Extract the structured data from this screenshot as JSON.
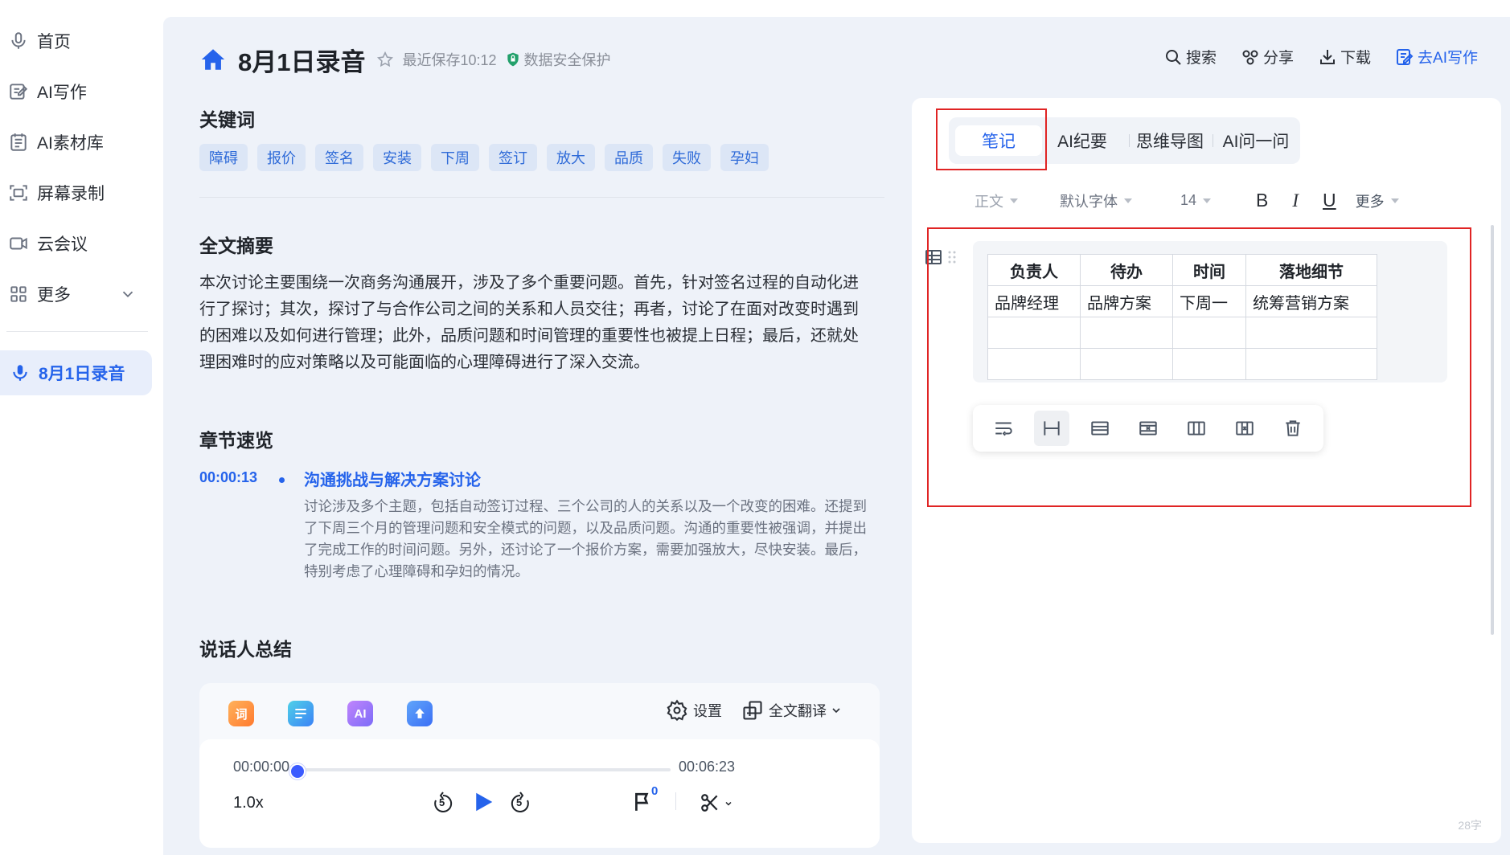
{
  "sidebar": {
    "items": [
      {
        "label": "首页",
        "icon": "microphone-icon"
      },
      {
        "label": "AI写作",
        "icon": "edit-icon"
      },
      {
        "label": "AI素材库",
        "icon": "library-icon"
      },
      {
        "label": "屏幕录制",
        "icon": "screen-record-icon"
      },
      {
        "label": "云会议",
        "icon": "video-icon"
      },
      {
        "label": "更多",
        "icon": "grid-icon"
      }
    ],
    "recent": {
      "label": "8月1日录音",
      "icon": "microphone-icon"
    }
  },
  "header": {
    "title": "8月1日录音",
    "save_status": "最近保存10:12",
    "security": "数据安全保护",
    "actions": {
      "search": "搜索",
      "share": "分享",
      "download": "下载",
      "ai_write": "去AI写作"
    }
  },
  "keywords": {
    "title": "关键词",
    "items": [
      "障碍",
      "报价",
      "签名",
      "安装",
      "下周",
      "签订",
      "放大",
      "品质",
      "失败",
      "孕妇"
    ]
  },
  "summary": {
    "title": "全文摘要",
    "text": "本次讨论主要围绕一次商务沟通展开，涉及了多个重要问题。首先，针对签名过程的自动化进行了探讨；其次，探讨了与合作公司之间的关系和人员交往；再者，讨论了在面对改变时遇到的困难以及如何进行管理；此外，品质问题和时间管理的重要性也被提上日程；最后，还就处理困难时的应对策略以及可能面临的心理障碍进行了深入交流。"
  },
  "chapters": {
    "title": "章节速览",
    "items": [
      {
        "time": "00:00:13",
        "title": "沟通挑战与解决方案讨论",
        "body": "讨论涉及多个主题，包括自动签订过程、三个公司的人的关系以及一个改变的困难。还提到了下周三个月的管理问题和安全模式的问题，以及品质问题。沟通的重要性被强调，并提出了完成工作的时间问题。另外，还讨论了一个报价方案，需要加强放大，尽快安装。最后，特别考虑了心理障碍和孕妇的情况。"
      }
    ]
  },
  "speakers": {
    "title": "说话人总结"
  },
  "player": {
    "tools": [
      "词",
      "AI"
    ],
    "settings": "设置",
    "translate": "全文翻译",
    "current_time": "00:00:00",
    "total_time": "00:06:23",
    "progress": 0,
    "speed": "1.0x",
    "skip_seconds": "5",
    "flag_count": "0"
  },
  "note": {
    "tabs": [
      "笔记",
      "AI纪要",
      "思维导图",
      "AI问一问"
    ],
    "active_tab": 0,
    "format": {
      "style": "正文",
      "font": "默认字体",
      "size": "14",
      "bold": "B",
      "italic": "I",
      "underline": "U",
      "more": "更多"
    },
    "table": {
      "headers": [
        "负责人",
        "待办",
        "时间",
        "落地细节"
      ],
      "rows": [
        [
          "品牌经理",
          "品牌方案",
          "下周一",
          "统筹营销方案"
        ],
        [
          "",
          "",
          "",
          ""
        ],
        [
          "",
          "",
          "",
          ""
        ]
      ]
    },
    "word_count": "28字"
  },
  "colors": {
    "accent": "#2563eb",
    "highlight_box": "#e02424"
  }
}
